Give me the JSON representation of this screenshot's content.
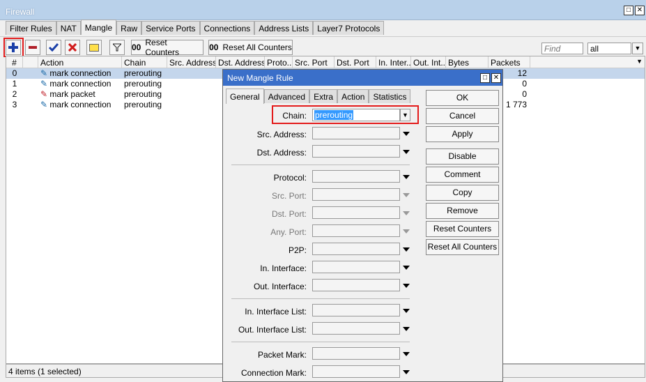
{
  "window": {
    "title": "Firewall"
  },
  "tabs": [
    "Filter Rules",
    "NAT",
    "Mangle",
    "Raw",
    "Service Ports",
    "Connections",
    "Address Lists",
    "Layer7 Protocols"
  ],
  "toolbar": {
    "reset_counters": "Reset Counters",
    "reset_all_counters": "Reset All Counters",
    "find_placeholder": "Find",
    "filter_value": "all"
  },
  "table": {
    "columns": [
      "#",
      "Action",
      "Chain",
      "Src. Address",
      "Dst. Address",
      "Proto...",
      "Src. Port",
      "Dst. Port",
      "In. Inter...",
      "Out. Int...",
      "Bytes",
      "Packets"
    ],
    "rows": [
      {
        "num": "0",
        "action": "mark connection",
        "chain": "prerouting",
        "packets": "12"
      },
      {
        "num": "1",
        "action": "mark connection",
        "chain": "prerouting",
        "packets": "0"
      },
      {
        "num": "2",
        "action": "mark packet",
        "chain": "prerouting",
        "packets": "0"
      },
      {
        "num": "3",
        "action": "mark connection",
        "chain": "prerouting",
        "packets": "1 773"
      }
    ]
  },
  "status": "4 items (1 selected)",
  "dialog": {
    "title": "New Mangle Rule",
    "tabs": [
      "General",
      "Advanced",
      "Extra",
      "Action",
      "Statistics"
    ],
    "chain_label": "Chain:",
    "chain_value": "prerouting",
    "fields": [
      "Src. Address:",
      "Dst. Address:",
      "Protocol:",
      "Src. Port:",
      "Dst. Port:",
      "Any. Port:",
      "P2P:",
      "In. Interface:",
      "Out. Interface:",
      "In. Interface List:",
      "Out. Interface List:",
      "Packet Mark:",
      "Connection Mark:"
    ],
    "buttons": [
      "OK",
      "Cancel",
      "Apply",
      "Disable",
      "Comment",
      "Copy",
      "Remove",
      "Reset Counters",
      "Reset All Counters"
    ]
  },
  "colors": {
    "accent_red": "#e31b1b",
    "title_blue": "#3a6fc9",
    "selected_row": "#c4d6ec"
  }
}
